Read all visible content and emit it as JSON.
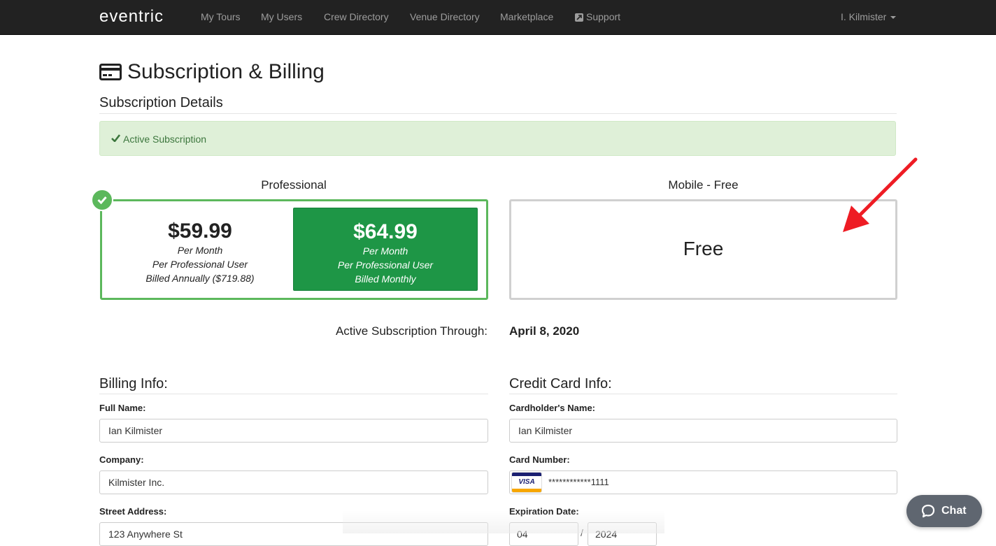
{
  "nav": {
    "brand": "eventric",
    "items": [
      "My Tours",
      "My Users",
      "Crew Directory",
      "Venue Directory",
      "Marketplace"
    ],
    "support": "Support",
    "user": "I. Kilmister"
  },
  "page": {
    "title": "Subscription & Billing",
    "section": "Subscription Details",
    "alert": "Active Subscription"
  },
  "plans": {
    "professional": {
      "name": "Professional",
      "annual": {
        "price": "$59.99",
        "line1": "Per Month",
        "line2": "Per Professional User",
        "line3": "Billed Annually ($719.88)"
      },
      "monthly": {
        "price": "$64.99",
        "line1": "Per Month",
        "line2": "Per Professional User",
        "line3": "Billed Monthly"
      }
    },
    "mobile": {
      "name": "Mobile - Free",
      "price": "Free"
    }
  },
  "through": {
    "label": "Active Subscription Through:",
    "value": "April 8, 2020"
  },
  "billing": {
    "heading": "Billing Info:",
    "full_name_label": "Full Name:",
    "full_name": "Ian Kilmister",
    "company_label": "Company:",
    "company": "Kilmister Inc.",
    "street_label": "Street Address:",
    "street": "123 Anywhere St"
  },
  "card": {
    "heading": "Credit Card Info:",
    "holder_label": "Cardholder's Name:",
    "holder": "Ian Kilmister",
    "number_label": "Card Number:",
    "number": "************1111",
    "brand": "VISA",
    "exp_label": "Expiration Date:",
    "exp_month": "04",
    "exp_year": "2024"
  },
  "chat": {
    "label": "Chat"
  },
  "colors": {
    "accent_green": "#1e9646",
    "border_green": "#5cb85c",
    "annotation_red": "#ee1c24"
  }
}
